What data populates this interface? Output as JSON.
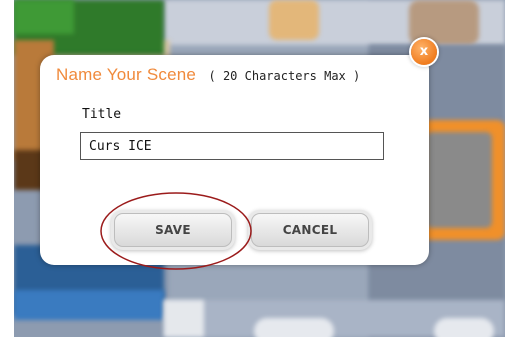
{
  "dialog": {
    "title": "Name Your Scene",
    "hint": "( 20 Characters Max )",
    "field_label": "Title",
    "field_value": "Curs ICE",
    "save_label": "SAVE",
    "cancel_label": "CANCEL",
    "close_glyph": "x"
  },
  "colors": {
    "title_accent": "#f08a3c",
    "close_button": "#f07c1e",
    "annotation_ring": "#9b1b1b"
  },
  "icons": {
    "close": "close-icon"
  }
}
